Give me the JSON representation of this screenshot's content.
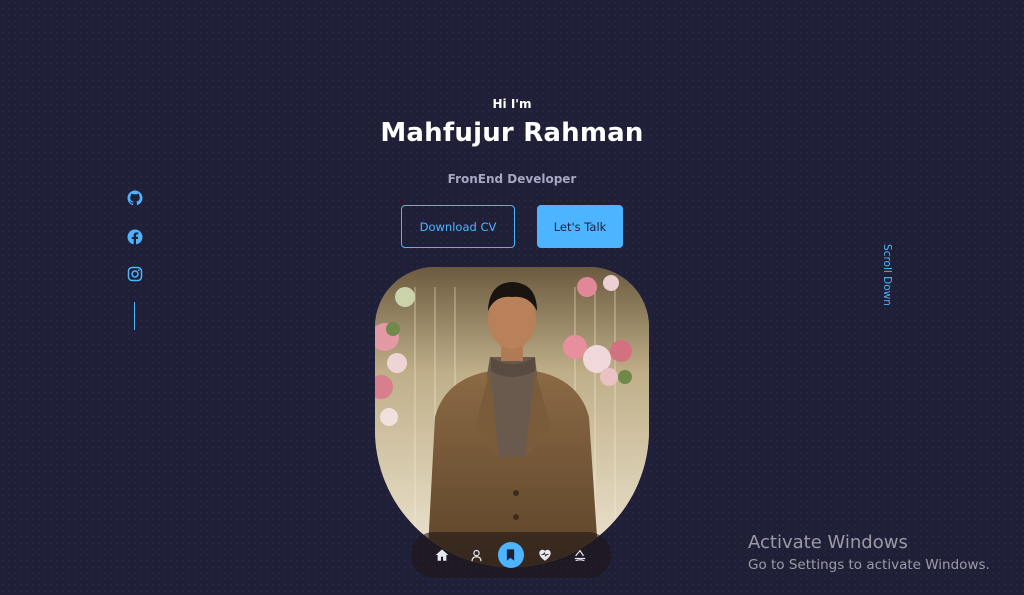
{
  "hero": {
    "intro": "Hi I'm",
    "name": "Mahfujur Rahman",
    "role": "FronEnd Developer"
  },
  "buttons": {
    "download_cv": "Download CV",
    "lets_talk": "Let's Talk"
  },
  "socials": [
    {
      "name": "github-icon"
    },
    {
      "name": "facebook-icon"
    },
    {
      "name": "instagram-icon"
    }
  ],
  "scroll_down": "Scroll Down",
  "bottom_nav": {
    "items": [
      "home-icon",
      "user-icon",
      "bookmark-icon",
      "heart-icon",
      "message-icon"
    ],
    "active_index": 2
  },
  "watermark": {
    "title": "Activate Windows",
    "subtitle": "Go to Settings to activate Windows."
  },
  "colors": {
    "background": "#1f1f38",
    "accent": "#4db5ff",
    "muted_text": "#a6a7c2"
  }
}
